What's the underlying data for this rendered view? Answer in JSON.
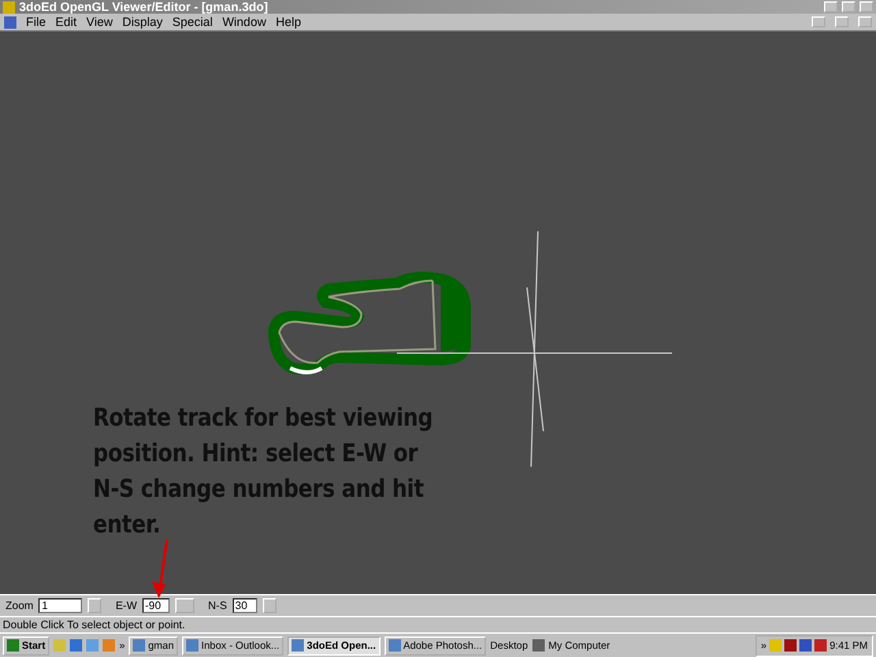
{
  "window": {
    "title": "3doEd OpenGL Viewer/Editor - [gman.3do]"
  },
  "menu": [
    "File",
    "Edit",
    "View",
    "Display",
    "Special",
    "Window",
    "Help"
  ],
  "annotation": "Rotate track for best viewing position. Hint: select E-W or N-S change numbers and hit enter.",
  "controls": [
    {
      "label": "Zoom",
      "value": "1"
    },
    {
      "label": "E-W",
      "value": "-90"
    },
    {
      "label": "N-S",
      "value": "30"
    }
  ],
  "status_bar": "Double Click To select object or point.",
  "taskbar": {
    "start": "Start",
    "more": "»",
    "tasks": [
      {
        "label": "gman",
        "selected": false
      },
      {
        "label": "Inbox - Outlook...",
        "selected": false
      },
      {
        "label": "3doEd Open...",
        "selected": true
      },
      {
        "label": "Adobe Photosh...",
        "selected": false
      }
    ],
    "toolbars": [
      "Desktop",
      "My Computer"
    ],
    "tray_more": "»",
    "clock": "9:41 PM"
  }
}
